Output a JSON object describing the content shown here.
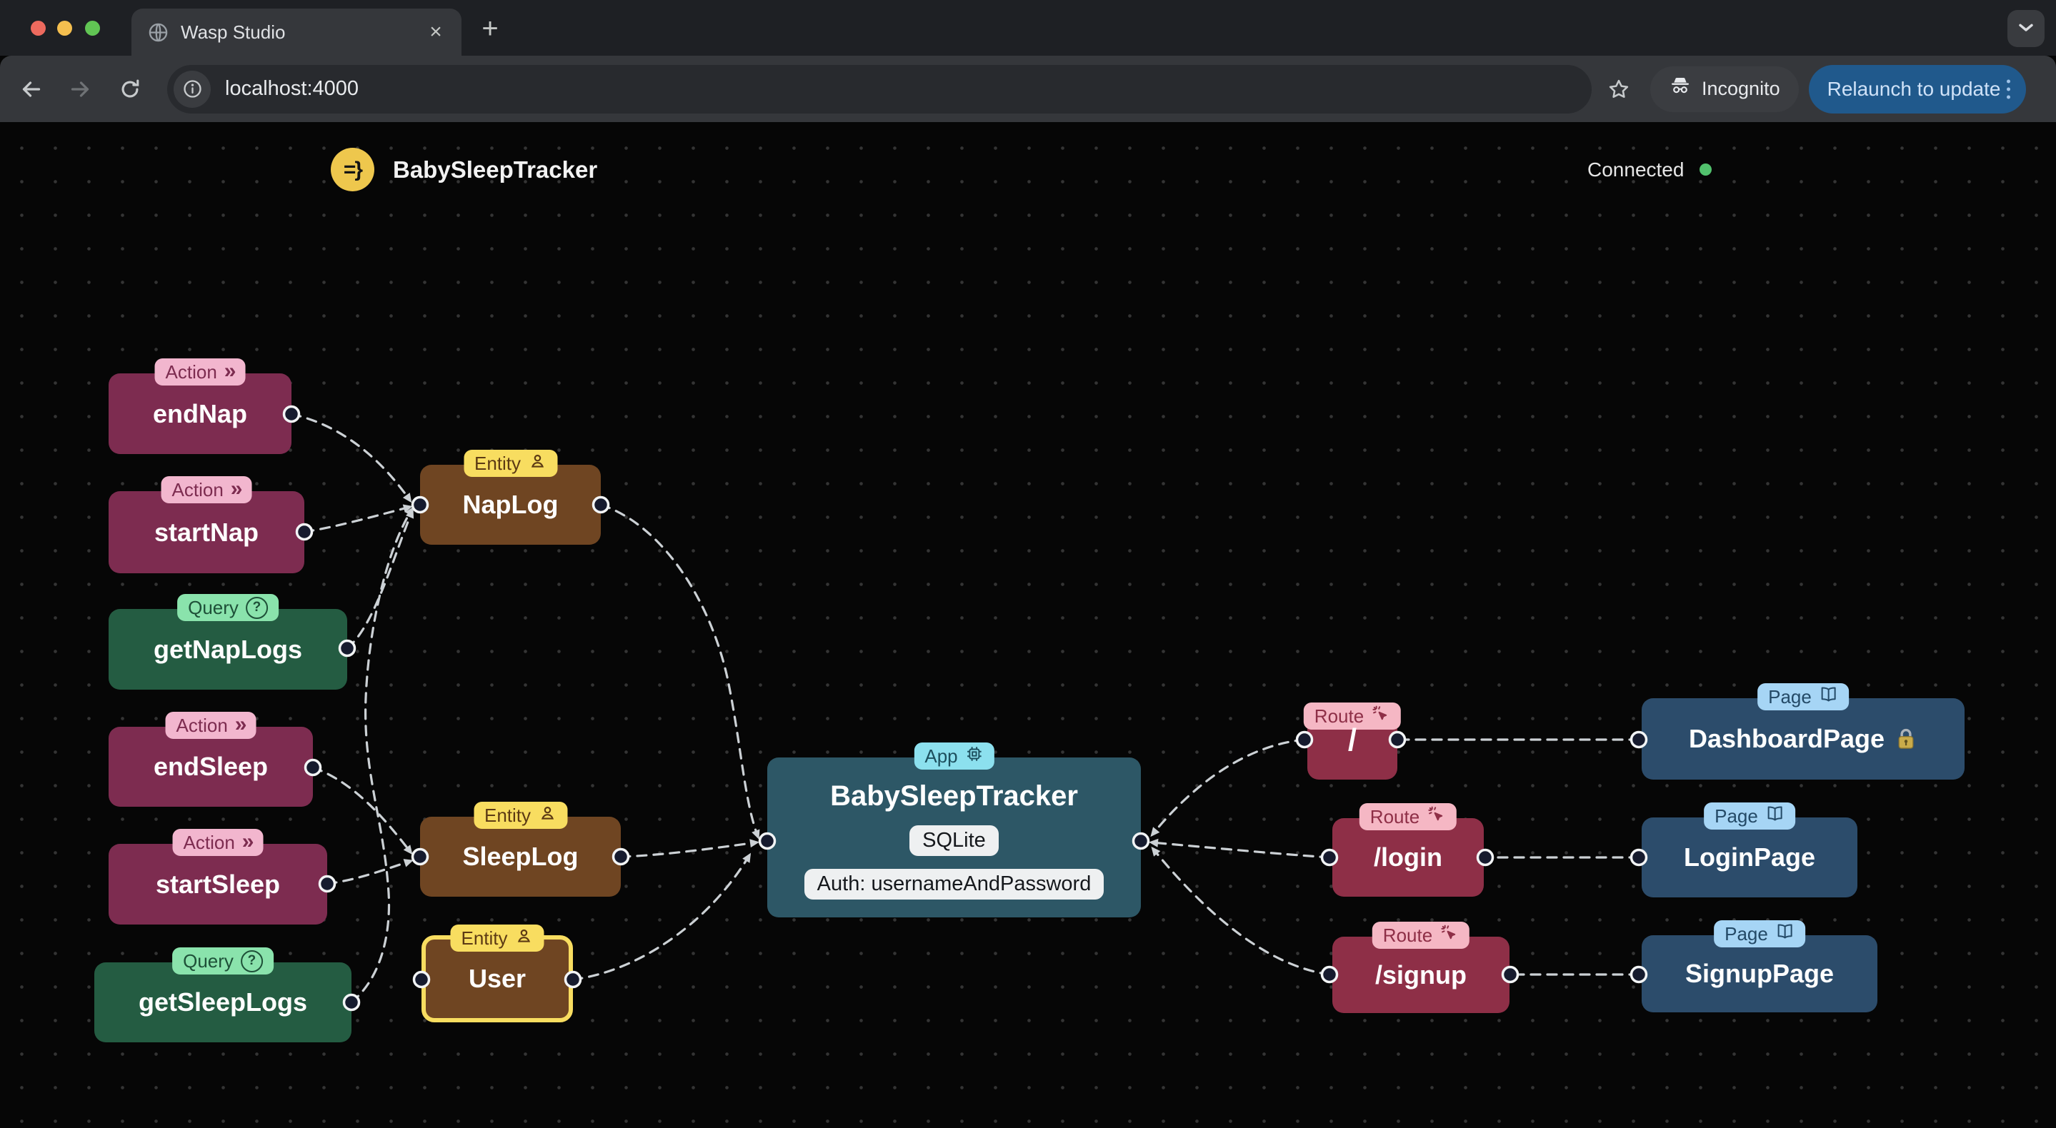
{
  "browser": {
    "tab": {
      "title": "Wasp Studio",
      "close_glyph": "×",
      "new_tab_glyph": "+"
    },
    "toolbar": {
      "url": "localhost:4000",
      "incognito_label": "Incognito",
      "relaunch_label": "Relaunch to update"
    },
    "colors": {
      "relaunch_bg": "#20598c",
      "relaunch_text": "#cfe2f8",
      "toolbar_bg": "#35373b"
    }
  },
  "header": {
    "logo_text": "=}",
    "app_title": "BabySleepTracker",
    "connection_status": "Connected",
    "connection_color": "#52c16d"
  },
  "icons": [
    "globe-icon",
    "info-icon",
    "back-arrow-icon",
    "forward-arrow-icon",
    "reload-icon",
    "star-icon",
    "incognito-icon",
    "kebab-menu-icon",
    "chevron-down-icon",
    "person-icon",
    "chip-icon",
    "cursor-click-icon",
    "book-icon",
    "question-icon",
    "double-chevron-icon",
    "lock-icon",
    "wasp-logo"
  ],
  "node_types": {
    "action": {
      "bg": "#7d2c50",
      "badgeBg": "#f2b6ce",
      "badgeText": "#7d2c50"
    },
    "query": {
      "bg": "#245c42",
      "badgeBg": "#8ae3ac",
      "badgeText": "#1e5038"
    },
    "entity": {
      "bg": "#6f4522",
      "badgeBg": "#f8dd60",
      "badgeText": "#5c3a14"
    },
    "app": {
      "bg": "#2d5766",
      "badgeBg": "#8ce0ee",
      "badgeText": "#1d4f5e"
    },
    "route": {
      "bg": "#8e2f47",
      "badgeBg": "#f5b7c4",
      "badgeText": "#8e2f47"
    },
    "page": {
      "bg": "#2c4c6b",
      "badgeBg": "#a6d5f5",
      "badgeText": "#244a67"
    }
  },
  "nodes": [
    {
      "id": "endNap",
      "type": "action",
      "badge": "Action",
      "title": "endNap"
    },
    {
      "id": "startNap",
      "type": "action",
      "badge": "Action",
      "title": "startNap"
    },
    {
      "id": "getNapLogs",
      "type": "query",
      "badge": "Query",
      "title": "getNapLogs"
    },
    {
      "id": "endSleep",
      "type": "action",
      "badge": "Action",
      "title": "endSleep"
    },
    {
      "id": "startSleep",
      "type": "action",
      "badge": "Action",
      "title": "startSleep"
    },
    {
      "id": "getSleepLogs",
      "type": "query",
      "badge": "Query",
      "title": "getSleepLogs"
    },
    {
      "id": "NapLog",
      "type": "entity",
      "badge": "Entity",
      "title": "NapLog"
    },
    {
      "id": "SleepLog",
      "type": "entity",
      "badge": "Entity",
      "title": "SleepLog"
    },
    {
      "id": "User",
      "type": "entity",
      "badge": "Entity",
      "title": "User",
      "highlighted": true
    },
    {
      "id": "App",
      "type": "app",
      "badge": "App",
      "title": "BabySleepTracker",
      "pills": [
        "SQLite",
        "Auth: usernameAndPassword"
      ]
    },
    {
      "id": "RouteRoot",
      "type": "route",
      "badge": "Route",
      "title": "/"
    },
    {
      "id": "RouteLogin",
      "type": "route",
      "badge": "Route",
      "title": "/login"
    },
    {
      "id": "RouteSignup",
      "type": "route",
      "badge": "Route",
      "title": "/signup"
    },
    {
      "id": "DashboardPage",
      "type": "page",
      "badge": "Page",
      "title": "DashboardPage",
      "locked": true
    },
    {
      "id": "LoginPage",
      "type": "page",
      "badge": "Page",
      "title": "LoginPage"
    },
    {
      "id": "SignupPage",
      "type": "page",
      "badge": "Page",
      "title": "SignupPage"
    }
  ]
}
